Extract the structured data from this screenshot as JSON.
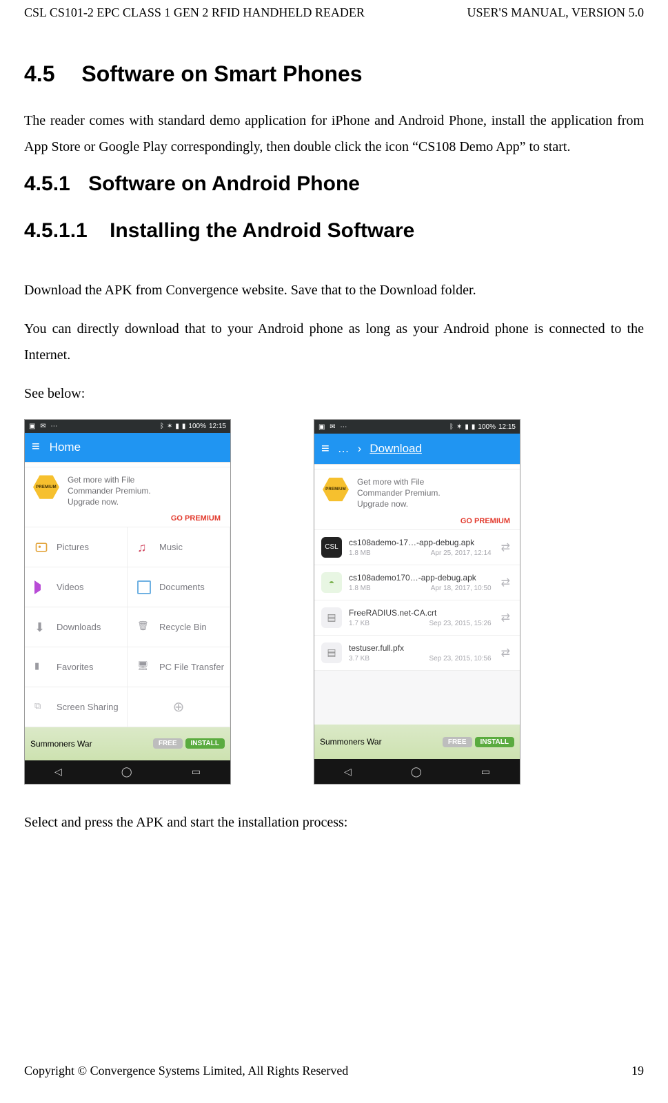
{
  "header": {
    "left": "CSL CS101-2 EPC CLASS 1 GEN 2 RFID HANDHELD READER",
    "right": "USER'S  MANUAL,  VERSION  5.0"
  },
  "sections": {
    "main_num": "4.5",
    "main_title": "Software on Smart Phones",
    "intro_para": "The reader comes with standard demo application for iPhone and Android Phone, install the application from App Store or Google Play correspondingly, then double click the icon “CS108 Demo App” to start.",
    "sub1_num": "4.5.1",
    "sub1_title": "Software on Android Phone",
    "sub2_num": "4.5.1.1",
    "sub2_title": "Installing the Android Software",
    "para_download": "Download the APK from Convergence website.   Save that to the Download folder.",
    "para_direct": "You can directly download that to your Android phone as long as your Android phone is connected to the Internet.",
    "para_seebelow": "See below:",
    "para_select": "Select and press the APK and start the installation process:"
  },
  "status": {
    "battery": "100%",
    "time": "12:15"
  },
  "promo": {
    "hex_label": "PREMIUM",
    "line1": "Get more with File",
    "line2": "Commander Premium.",
    "line3": "Upgrade now.",
    "go": "GO PREMIUM"
  },
  "phone1": {
    "title": "Home",
    "tiles": [
      {
        "label": "Pictures"
      },
      {
        "label": "Music"
      },
      {
        "label": "Videos"
      },
      {
        "label": "Documents"
      },
      {
        "label": "Downloads"
      },
      {
        "label": "Recycle Bin"
      },
      {
        "label": "Favorites"
      },
      {
        "label": "PC File Transfer"
      },
      {
        "label": "Screen Sharing"
      },
      {
        "label": ""
      }
    ]
  },
  "phone2": {
    "breadcrumb_sep": "…",
    "breadcrumb_last": "Download",
    "files": [
      {
        "name": "cs108ademo-17…-app-debug.apk",
        "size": "1.8 MB",
        "date": "Apr 25, 2017, 12:14",
        "kind": "csl"
      },
      {
        "name": "cs108ademo170…-app-debug.apk",
        "size": "1.8 MB",
        "date": "Apr 18, 2017, 10:50",
        "kind": "and"
      },
      {
        "name": "FreeRADIUS.net-CA.crt",
        "size": "1.7 KB",
        "date": "Sep 23, 2015, 15:26",
        "kind": "doc"
      },
      {
        "name": "testuser.full.pfx",
        "size": "3.7 KB",
        "date": "Sep 23, 2015, 10:56",
        "kind": "doc"
      }
    ]
  },
  "ad": {
    "title": "Summoners War",
    "free": "FREE",
    "install": "INSTALL"
  },
  "footer": {
    "left": "Copyright © Convergence Systems Limited, All Rights Reserved",
    "right": "19"
  }
}
